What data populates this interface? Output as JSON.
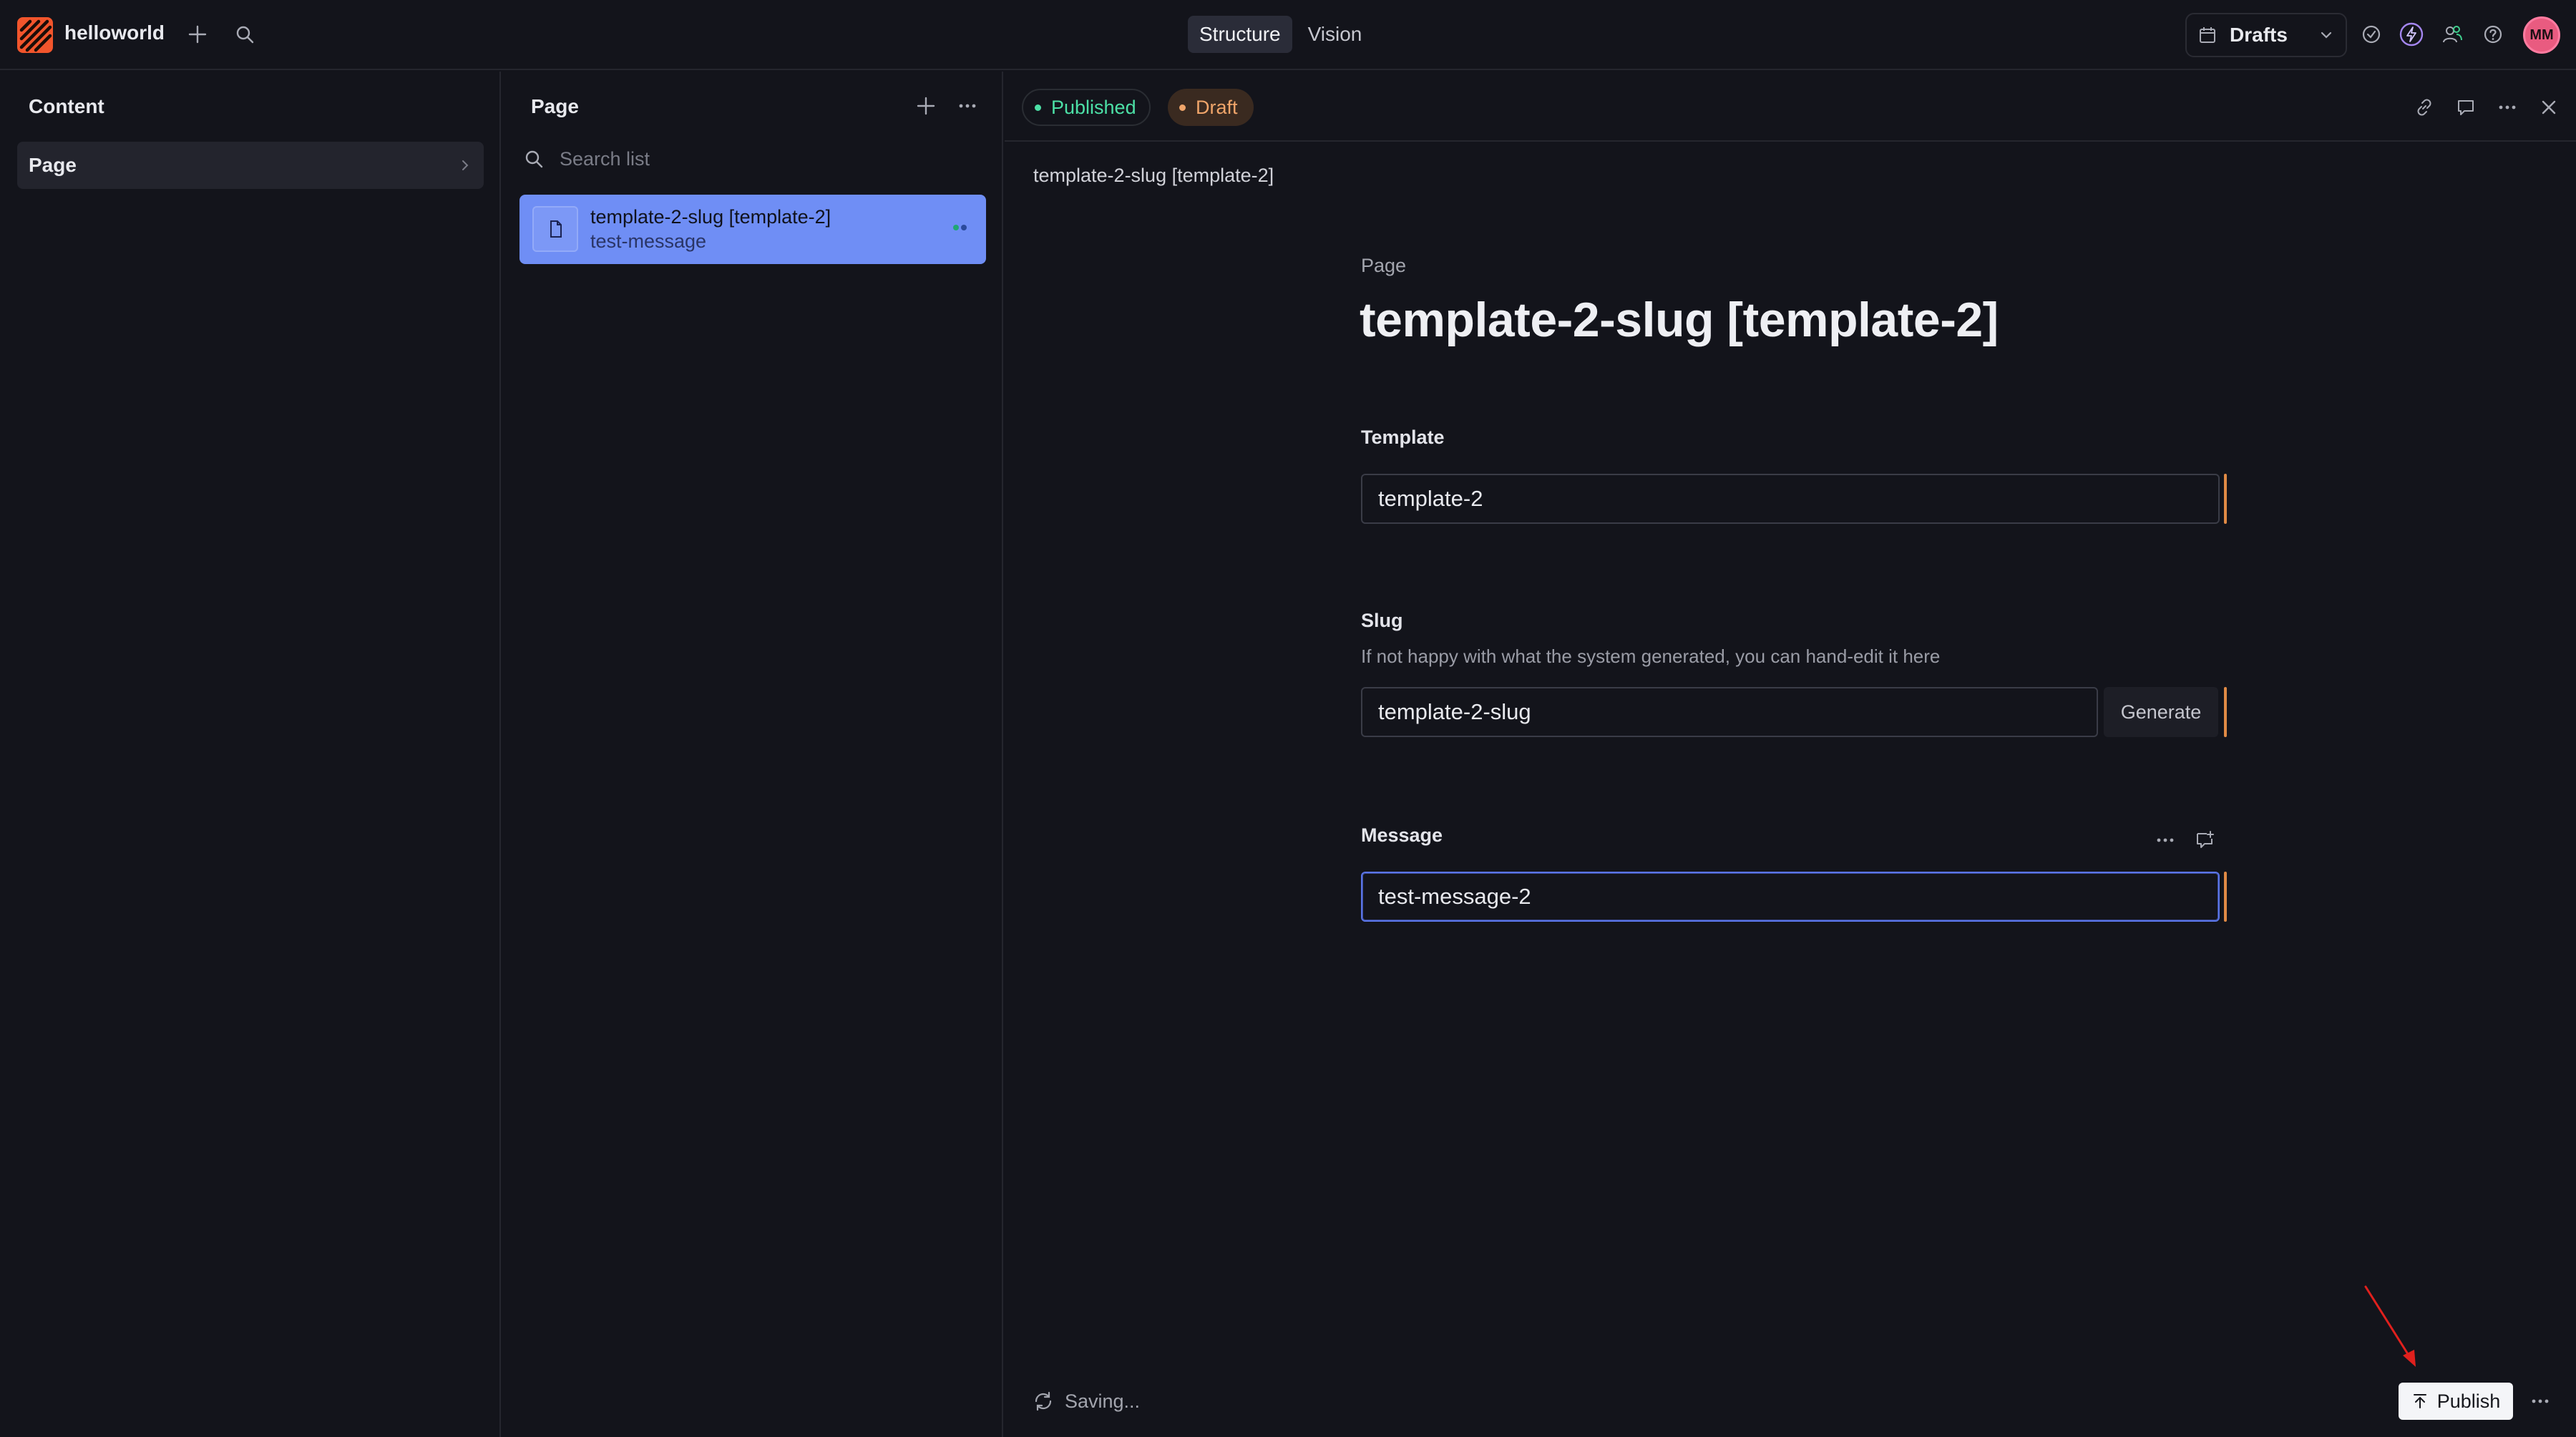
{
  "workspace": {
    "name": "helloworld"
  },
  "tools": [
    {
      "label": "Structure",
      "active": true
    },
    {
      "label": "Vision",
      "active": false
    }
  ],
  "release": {
    "label": "Drafts"
  },
  "user": {
    "initials": "MM",
    "avatar_color": "#e95b80"
  },
  "content_pane": {
    "title": "Content",
    "items": [
      {
        "label": "Page"
      }
    ]
  },
  "list_pane": {
    "title": "Page",
    "search": {
      "placeholder": "Search list",
      "value": ""
    },
    "items": [
      {
        "title": "template-2-slug [template-2]",
        "subtitle": "test-message",
        "selected": true
      }
    ]
  },
  "document": {
    "status_chips": [
      {
        "label": "Published",
        "color": "#4ce0a6"
      },
      {
        "label": "Draft",
        "color": "#f0a56a"
      }
    ],
    "breadcrumb": "template-2-slug [template-2]",
    "type_label": "Page",
    "title": "template-2-slug [template-2]",
    "fields": {
      "template": {
        "label": "Template",
        "value": "template-2"
      },
      "slug": {
        "label": "Slug",
        "description": "If not happy with what the system generated, you can hand-edit it here",
        "value": "template-2-slug",
        "action_label": "Generate"
      },
      "message": {
        "label": "Message",
        "value": "test-message-2"
      }
    },
    "footer": {
      "status": "Saving...",
      "publish_label": "Publish"
    }
  },
  "colors": {
    "accent": "#6f8ef5",
    "brand": "#f2552c",
    "changed": "#e08a45",
    "annotation": "#e0201d"
  }
}
